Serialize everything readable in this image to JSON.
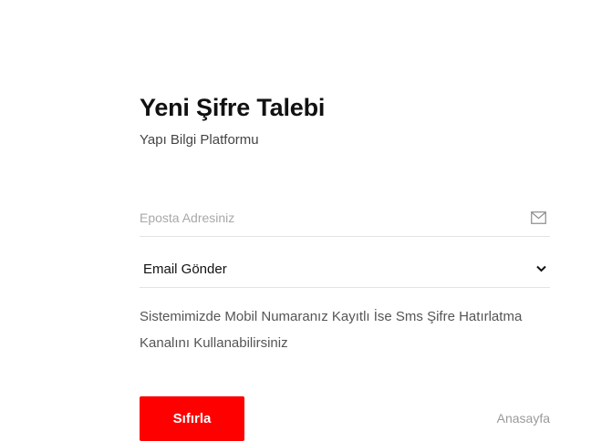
{
  "form": {
    "title": "Yeni Şifre Talebi",
    "subtitle": "Yapı Bilgi Platformu",
    "email_placeholder": "Eposta Adresiniz",
    "email_icon": "mail-icon",
    "method_select": {
      "selected": "Email Gönder",
      "icon": "chevron-down-icon"
    },
    "info_text": "Sistemimizde Mobil Numaranız Kayıtlı İse Sms Şifre Hatırlatma Kanalını Kullanabilirsiniz",
    "submit_label": "Sıfırla",
    "home_link": "Anasayfa",
    "colors": {
      "accent": "#ff0000",
      "background": "#ffffff"
    }
  }
}
